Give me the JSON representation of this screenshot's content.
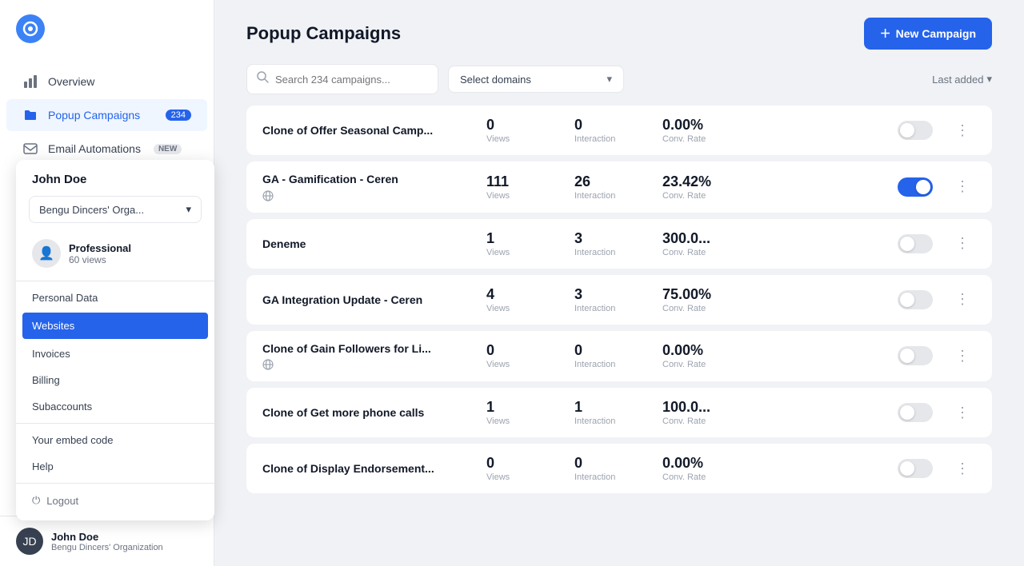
{
  "sidebar": {
    "nav_items": [
      {
        "id": "overview",
        "label": "Overview",
        "icon": "chart",
        "active": false
      },
      {
        "id": "popup-campaigns",
        "label": "Popup Campaigns",
        "icon": "folder",
        "active": true,
        "badge": "234"
      },
      {
        "id": "email-automations",
        "label": "Email Automations",
        "icon": "mail",
        "active": false,
        "badge_new": "NEW"
      }
    ]
  },
  "user_dropdown": {
    "user_name": "John Doe",
    "org_name": "Bengu Dincers' Orga...",
    "plan_name": "Professional",
    "plan_views": "60 views",
    "menu_items": [
      {
        "id": "personal-data",
        "label": "Personal Data",
        "active": false
      },
      {
        "id": "websites",
        "label": "Websites",
        "active": true
      },
      {
        "id": "invoices",
        "label": "Invoices",
        "active": false
      },
      {
        "id": "billing",
        "label": "Billing",
        "active": false
      },
      {
        "id": "subaccounts",
        "label": "Subaccounts",
        "active": false
      }
    ],
    "embed_code_label": "Your embed code",
    "help_label": "Help",
    "logout_label": "Logout"
  },
  "sidebar_bottom": {
    "user_name": "John Doe",
    "user_org": "Bengu Dincers' Organization"
  },
  "header": {
    "title": "Popup Campaigns",
    "new_campaign_btn": "New Campaign"
  },
  "filters": {
    "search_placeholder": "Search 234 campaigns...",
    "domain_select_label": "Select domains",
    "sort_label": "Last added"
  },
  "campaigns": [
    {
      "id": 1,
      "name": "Clone of Offer Seasonal Camp...",
      "has_domain": false,
      "views": 0,
      "interaction": 0,
      "conv_rate": "0.00%",
      "active": false
    },
    {
      "id": 2,
      "name": "GA - Gamification - Ceren",
      "has_domain": true,
      "views": 111,
      "interaction": 26,
      "conv_rate": "23.42%",
      "active": true
    },
    {
      "id": 3,
      "name": "Deneme",
      "has_domain": false,
      "views": 1,
      "interaction": 3,
      "conv_rate": "300.0...",
      "active": false
    },
    {
      "id": 4,
      "name": "GA Integration Update - Ceren",
      "has_domain": false,
      "views": 4,
      "interaction": 3,
      "conv_rate": "75.00%",
      "active": false
    },
    {
      "id": 5,
      "name": "Clone of Gain Followers for Li...",
      "has_domain": true,
      "views": 0,
      "interaction": 0,
      "conv_rate": "0.00%",
      "active": false
    },
    {
      "id": 6,
      "name": "Clone of Get more phone calls",
      "has_domain": false,
      "views": 1,
      "interaction": 1,
      "conv_rate": "100.0...",
      "active": false
    },
    {
      "id": 7,
      "name": "Clone of Display Endorsement...",
      "has_domain": false,
      "views": 0,
      "interaction": 0,
      "conv_rate": "0.00%",
      "active": false
    }
  ],
  "labels": {
    "views": "Views",
    "interaction": "Interaction",
    "conv_rate": "Conv. Rate"
  }
}
